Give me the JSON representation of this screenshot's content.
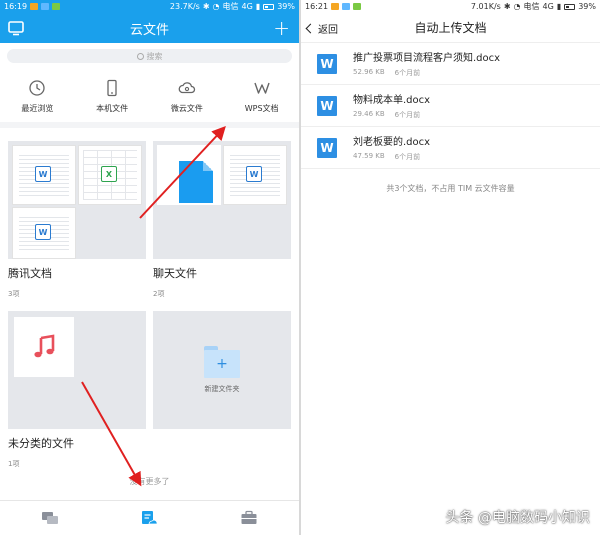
{
  "left": {
    "status": {
      "time": "16:19",
      "speed": "23.7K/s",
      "carrier": "电信",
      "network": "4G",
      "battery": "39%"
    },
    "header": {
      "title": "云文件"
    },
    "search": {
      "placeholder": "搜索"
    },
    "quick": [
      {
        "label": "最近浏览",
        "icon": "clock-icon"
      },
      {
        "label": "本机文件",
        "icon": "phone-icon"
      },
      {
        "label": "微云文件",
        "icon": "cloud-icon"
      },
      {
        "label": "WPS文档",
        "icon": "wps-icon"
      }
    ],
    "cards": [
      {
        "title": "腾讯文档",
        "sub": "3项"
      },
      {
        "title": "聊天文件",
        "sub": "2项"
      },
      {
        "title": "未分类的文件",
        "sub": "1项"
      },
      {
        "title": "",
        "sub": ""
      }
    ],
    "badges": {
      "word": "W",
      "excel": "X"
    },
    "new_folder_label": "新建文件夹",
    "folder_plus": "+",
    "no_more": "没有更多了",
    "tabs": [
      "chat-icon",
      "files-icon",
      "toolbox-icon"
    ],
    "accent": "#1aa0ec"
  },
  "right": {
    "status": {
      "time": "16:21",
      "speed": "7.01K/s",
      "carrier": "电信",
      "network": "4G",
      "battery": "39%"
    },
    "header": {
      "back": "返回",
      "title": "自动上传文档"
    },
    "files": [
      {
        "name": "推广投票项目流程客户须知.docx",
        "size": "52.96 KB",
        "time": "6个月前"
      },
      {
        "name": "物料成本单.docx",
        "size": "29.46 KB",
        "time": "6个月前"
      },
      {
        "name": "刘老板要的.docx",
        "size": "47.59 KB",
        "time": "6个月前"
      }
    ],
    "file_icon_letter": "W",
    "summary": "共3个文档，不占用 TIM 云文件容量"
  },
  "watermark": "头条 @电脑数码小知识"
}
